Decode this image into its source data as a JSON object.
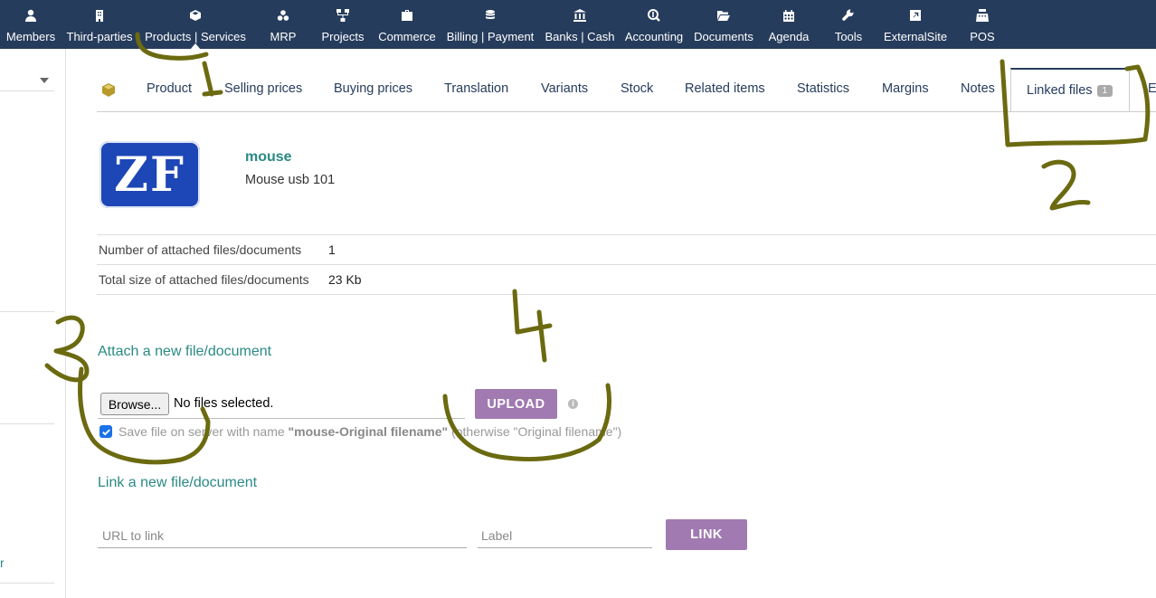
{
  "topbar": {
    "items": [
      {
        "label": "Members",
        "icon": "user-icon"
      },
      {
        "label": "Third-parties",
        "icon": "building-icon"
      },
      {
        "label": "Products | Services",
        "icon": "cube-icon"
      },
      {
        "label": "MRP",
        "icon": "cubes-icon"
      },
      {
        "label": "Projects",
        "icon": "sitemap-icon"
      },
      {
        "label": "Commerce",
        "icon": "briefcase-icon"
      },
      {
        "label": "Billing | Payment",
        "icon": "coins-icon"
      },
      {
        "label": "Banks | Cash",
        "icon": "bank-icon"
      },
      {
        "label": "Accounting",
        "icon": "search-dollar-icon"
      },
      {
        "label": "Documents",
        "icon": "folder-open-icon"
      },
      {
        "label": "Agenda",
        "icon": "calendar-icon"
      },
      {
        "label": "Tools",
        "icon": "wrench-icon"
      },
      {
        "label": "ExternalSite",
        "icon": "external-link-icon"
      },
      {
        "label": "POS",
        "icon": "cash-register-icon"
      }
    ],
    "active": "Products | Services"
  },
  "tabs": {
    "items": [
      "Product",
      "Selling prices",
      "Buying prices",
      "Translation",
      "Variants",
      "Stock",
      "Related items",
      "Statistics",
      "Margins",
      "Notes"
    ],
    "active_label": "Linked files",
    "active_badge": "1",
    "overflow_label": "E"
  },
  "product": {
    "logo_text": "ZF",
    "ref": "mouse",
    "label": "Mouse usb 101"
  },
  "info": {
    "rows": [
      {
        "label": "Number of attached files/documents",
        "value": "1"
      },
      {
        "label": "Total size of attached files/documents",
        "value": "23 Kb"
      }
    ]
  },
  "attach": {
    "title": "Attach a new file/document",
    "browse_label": "Browse...",
    "no_file_text": "No files selected.",
    "upload_label": "UPLOAD",
    "info_glyph": "i",
    "save_prefix": "Save file on server with name ",
    "save_name": "\"mouse-Original filename\"",
    "save_suffix": " (otherwise \"Original filename\")",
    "save_checked": true
  },
  "link": {
    "title": "Link a new file/document",
    "url_placeholder": "URL to link",
    "label_placeholder": "Label",
    "link_label": "LINK"
  },
  "annotations": [
    "1",
    "2",
    "3",
    "4"
  ],
  "colors": {
    "topbar": "#263c5c",
    "accent_link": "#2a8a84",
    "button": "#a07ab0",
    "annotation": "#6b6a10"
  }
}
